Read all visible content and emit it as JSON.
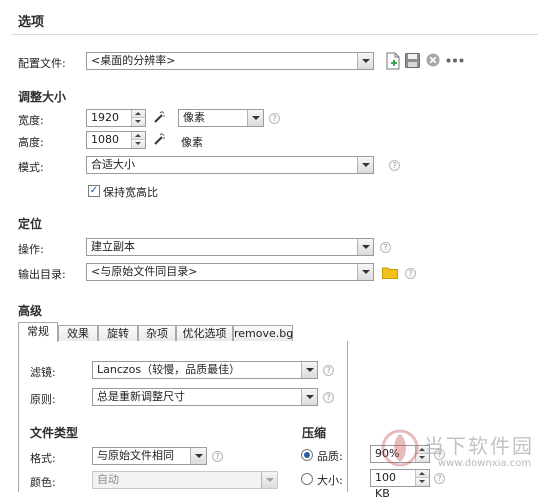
{
  "title": "选项",
  "profile": {
    "label": "配置文件:",
    "value": "<桌面的分辨率>"
  },
  "resize": {
    "heading": "调整大小",
    "width_label": "宽度:",
    "width_value": "1920",
    "height_label": "高度:",
    "height_value": "1080",
    "unit_select": "像素",
    "unit_text": "像素",
    "mode_label": "模式:",
    "mode_value": "合适大小",
    "keep_ratio": "保持宽高比"
  },
  "position": {
    "heading": "定位",
    "action_label": "操作:",
    "action_value": "建立副本",
    "output_label": "输出目录:",
    "output_value": "<与原始文件同目录>"
  },
  "advanced": {
    "heading": "高级",
    "tabs": [
      "常规",
      "效果",
      "旋转",
      "杂项",
      "优化选项",
      "remove.bg"
    ],
    "filter_label": "滤镜:",
    "filter_value": "Lanczos（较慢，品质最佳）",
    "rule_label": "原则:",
    "rule_value": "总是重新调整尺寸",
    "filetype_heading": "文件类型",
    "format_label": "格式:",
    "format_value": "与原始文件相同",
    "color_label": "颜色:",
    "color_value": "自动",
    "compress_heading": "压缩",
    "quality_label": "品质:",
    "quality_value": "90%",
    "size_label": "大小:",
    "size_value": "100 KB"
  },
  "watermark": {
    "name": "当下软件园",
    "url": "www.downxia.com"
  },
  "colors": {
    "folder": "#f2c21b",
    "new_file": "#2f9a3a",
    "delete": "#9c9c9c"
  }
}
